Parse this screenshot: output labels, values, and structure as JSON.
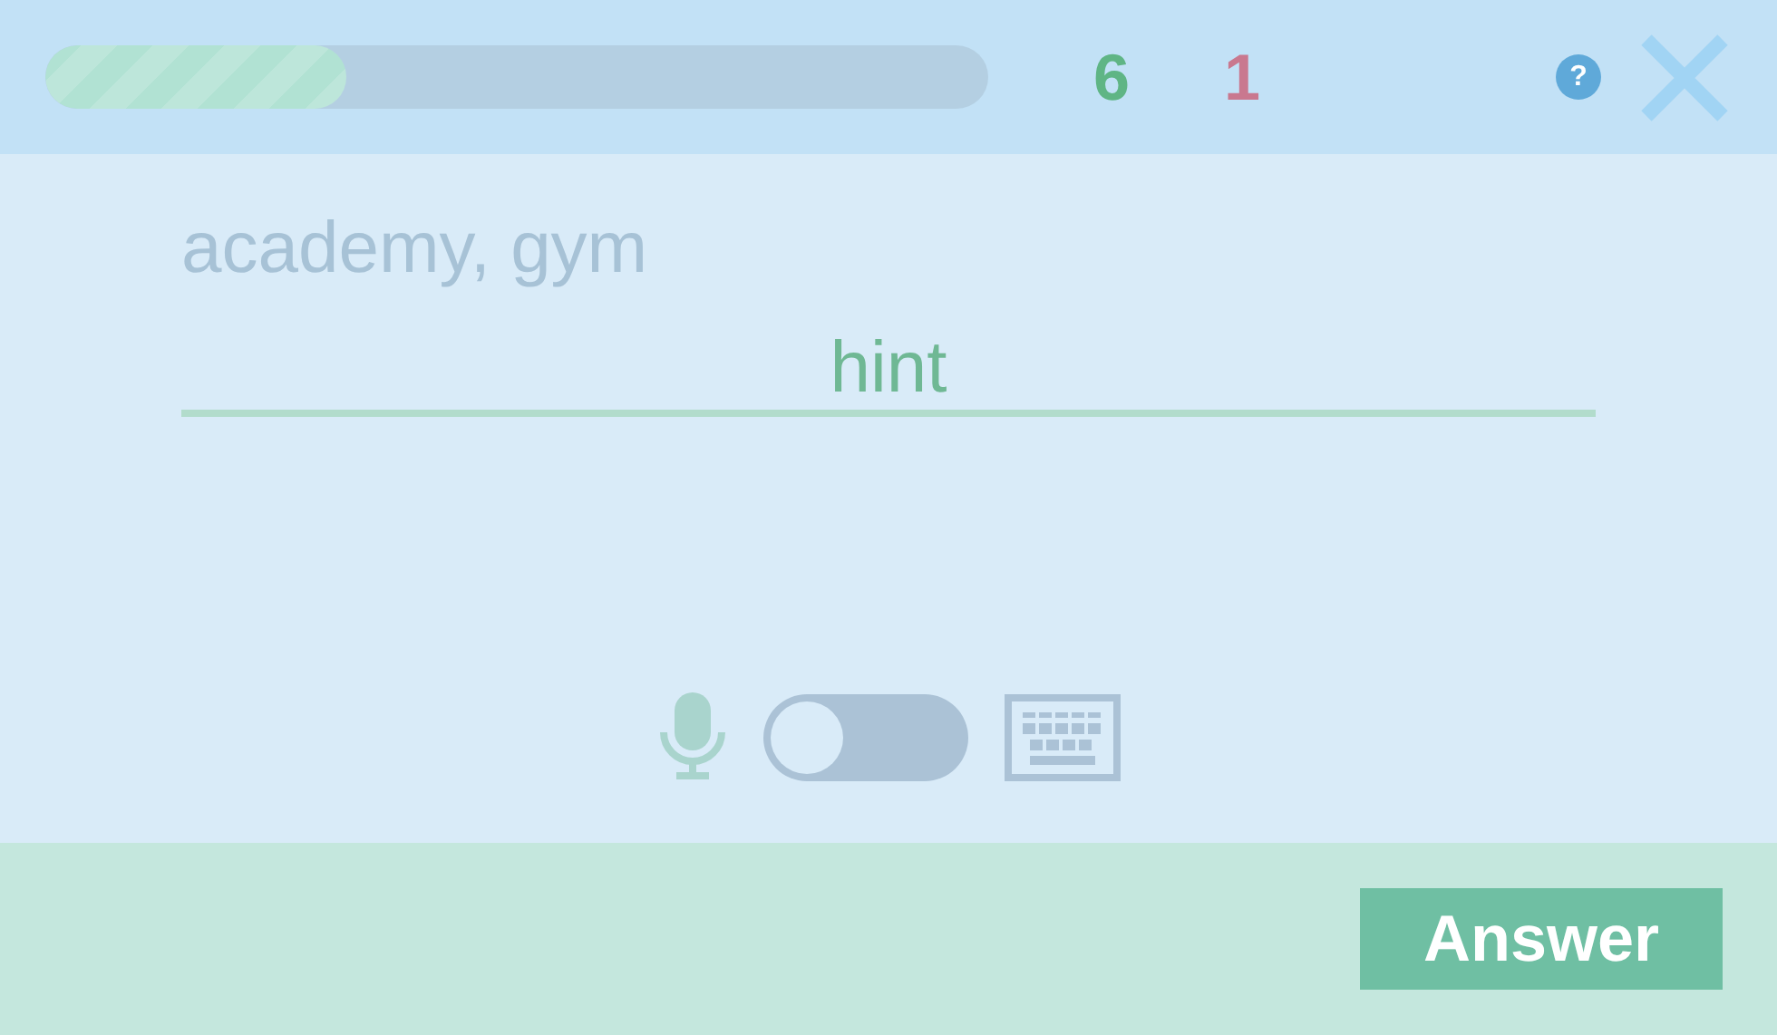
{
  "progress": {
    "level": 0.32
  },
  "score": {
    "correct": "6",
    "wrong": "1"
  },
  "help": {
    "label": "?"
  },
  "prompt": "academy, gym",
  "answer_field": {
    "placeholder": "hint"
  },
  "input_mode": {
    "keyboard": false
  },
  "footer": {
    "button": "Answer"
  }
}
